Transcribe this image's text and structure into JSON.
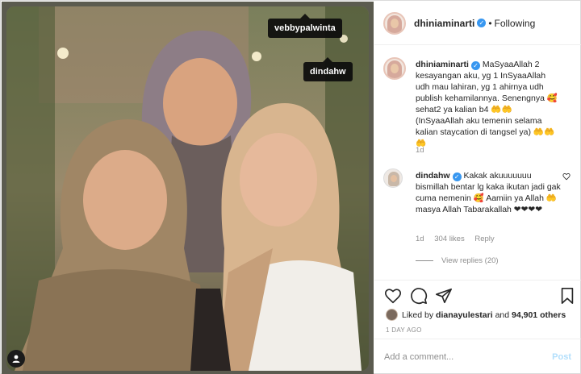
{
  "photo": {
    "tags": [
      "vebbypalwinta",
      "dindahw"
    ]
  },
  "header": {
    "username": "dhiniaminarti",
    "separator": "•",
    "follow_status": "Following"
  },
  "caption": {
    "username": "dhiniaminarti",
    "text": "MaSyaaAllah 2 kesayangan aku, yg 1 InSyaaAllah udh mau lahiran, yg 1 ahirnya udh publish kehamilannya. Senengnya 🥰 sehat2 ya kalian b4 🤲🤲 (InSyaaAllah aku temenin selama kalian staycation di tangsel ya) 🤲🤲🤲",
    "time": "1d"
  },
  "reply": {
    "username": "dindahw",
    "text": "Kakak akuuuuuuu bismillah bentar lg kaka ikutan jadi gak cuma nemenin 🥰 Aamiin ya Allah 🤲 masya Allah Tabarakallah ❤❤❤❤",
    "time": "1d",
    "likes": "304 likes",
    "reply_label": "Reply",
    "view_replies": "View replies (20)"
  },
  "likes": {
    "prefix": "Liked by",
    "user": "dianayulestari",
    "and": "and",
    "count": "94,901 others"
  },
  "time_ago": "1 DAY AGO",
  "add_comment": {
    "placeholder": "Add a comment...",
    "post_label": "Post"
  },
  "colors": {
    "verified": "#3897f0",
    "post_disabled": "#b2dffc",
    "muted": "#8e8e8e"
  }
}
